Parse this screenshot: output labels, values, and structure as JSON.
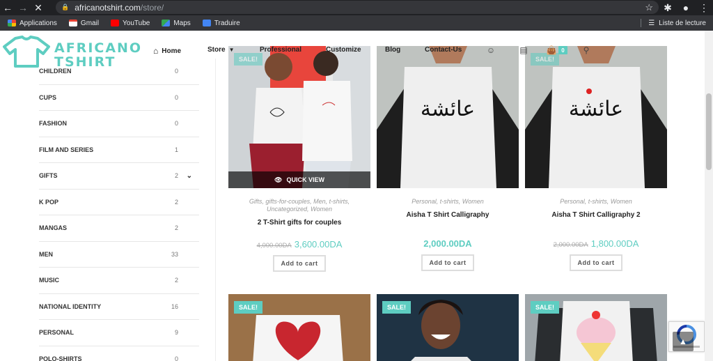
{
  "browser": {
    "url_domain": "africanotshirt.com",
    "url_path": "/store/",
    "bookmarks": [
      {
        "label": "Applications",
        "icon": "apps-grid-icon",
        "color": "#ea4335"
      },
      {
        "label": "Gmail",
        "icon": "gmail-icon",
        "color": "#ea4335"
      },
      {
        "label": "YouTube",
        "icon": "youtube-icon",
        "color": "#ff0000"
      },
      {
        "label": "Maps",
        "icon": "maps-icon",
        "color": "#34a853"
      },
      {
        "label": "Traduire",
        "icon": "translate-icon",
        "color": "#4285f4"
      }
    ],
    "reading_list": "Liste de lecture"
  },
  "site": {
    "logo_line1": "AFRICANO",
    "logo_line2": "TSHIRT",
    "accent_color": "#5ecdc1",
    "menu": [
      {
        "label": "Home",
        "icon": "home-icon"
      },
      {
        "label": "Store",
        "icon": "chevron-down-icon"
      },
      {
        "label": "Professional"
      },
      {
        "label": "Customize"
      },
      {
        "label": "Blog"
      },
      {
        "label": "Contact-Us"
      }
    ],
    "cart_count": "0"
  },
  "sidebar": {
    "categories": [
      {
        "name": "CHILDREN",
        "count": "0"
      },
      {
        "name": "CUPS",
        "count": "0"
      },
      {
        "name": "FASHION",
        "count": "0"
      },
      {
        "name": "FILM AND SERIES",
        "count": "1"
      },
      {
        "name": "GIFTS",
        "count": "2",
        "expandable": true
      },
      {
        "name": "K POP",
        "count": "2"
      },
      {
        "name": "MANGAS",
        "count": "2"
      },
      {
        "name": "MEN",
        "count": "33"
      },
      {
        "name": "MUSIC",
        "count": "2"
      },
      {
        "name": "NATIONAL IDENTITY",
        "count": "16"
      },
      {
        "name": "PERSONAL",
        "count": "9"
      },
      {
        "name": "POLO-SHIRTS",
        "count": "0"
      }
    ]
  },
  "products": [
    {
      "badge": "SALE!",
      "quick_view": "QUICK VIEW",
      "categories": "Gifts, gifts-for-couples, Men, t-shirts, Uncategorized, Women",
      "title": "2 T-Shirt gifts for couples",
      "old_price": "4,000.00DA",
      "price": "3,600.00DA",
      "button": "Add to cart"
    },
    {
      "badge": "",
      "categories": "Personal, t-shirts, Women",
      "title": "Aisha T Shirt Calligraphy",
      "old_price": "",
      "price": "2,000.00DA",
      "button": "Add to cart"
    },
    {
      "badge": "SALE!",
      "categories": "Personal, t-shirts, Women",
      "title": "Aisha T Shirt Calligraphy 2",
      "old_price": "2,000.00DA",
      "price": "1,800.00DA",
      "button": "Add to cart"
    }
  ],
  "products_row2": [
    {
      "badge": "SALE!"
    },
    {
      "badge": "SALE!"
    },
    {
      "badge": "SALE!"
    }
  ]
}
